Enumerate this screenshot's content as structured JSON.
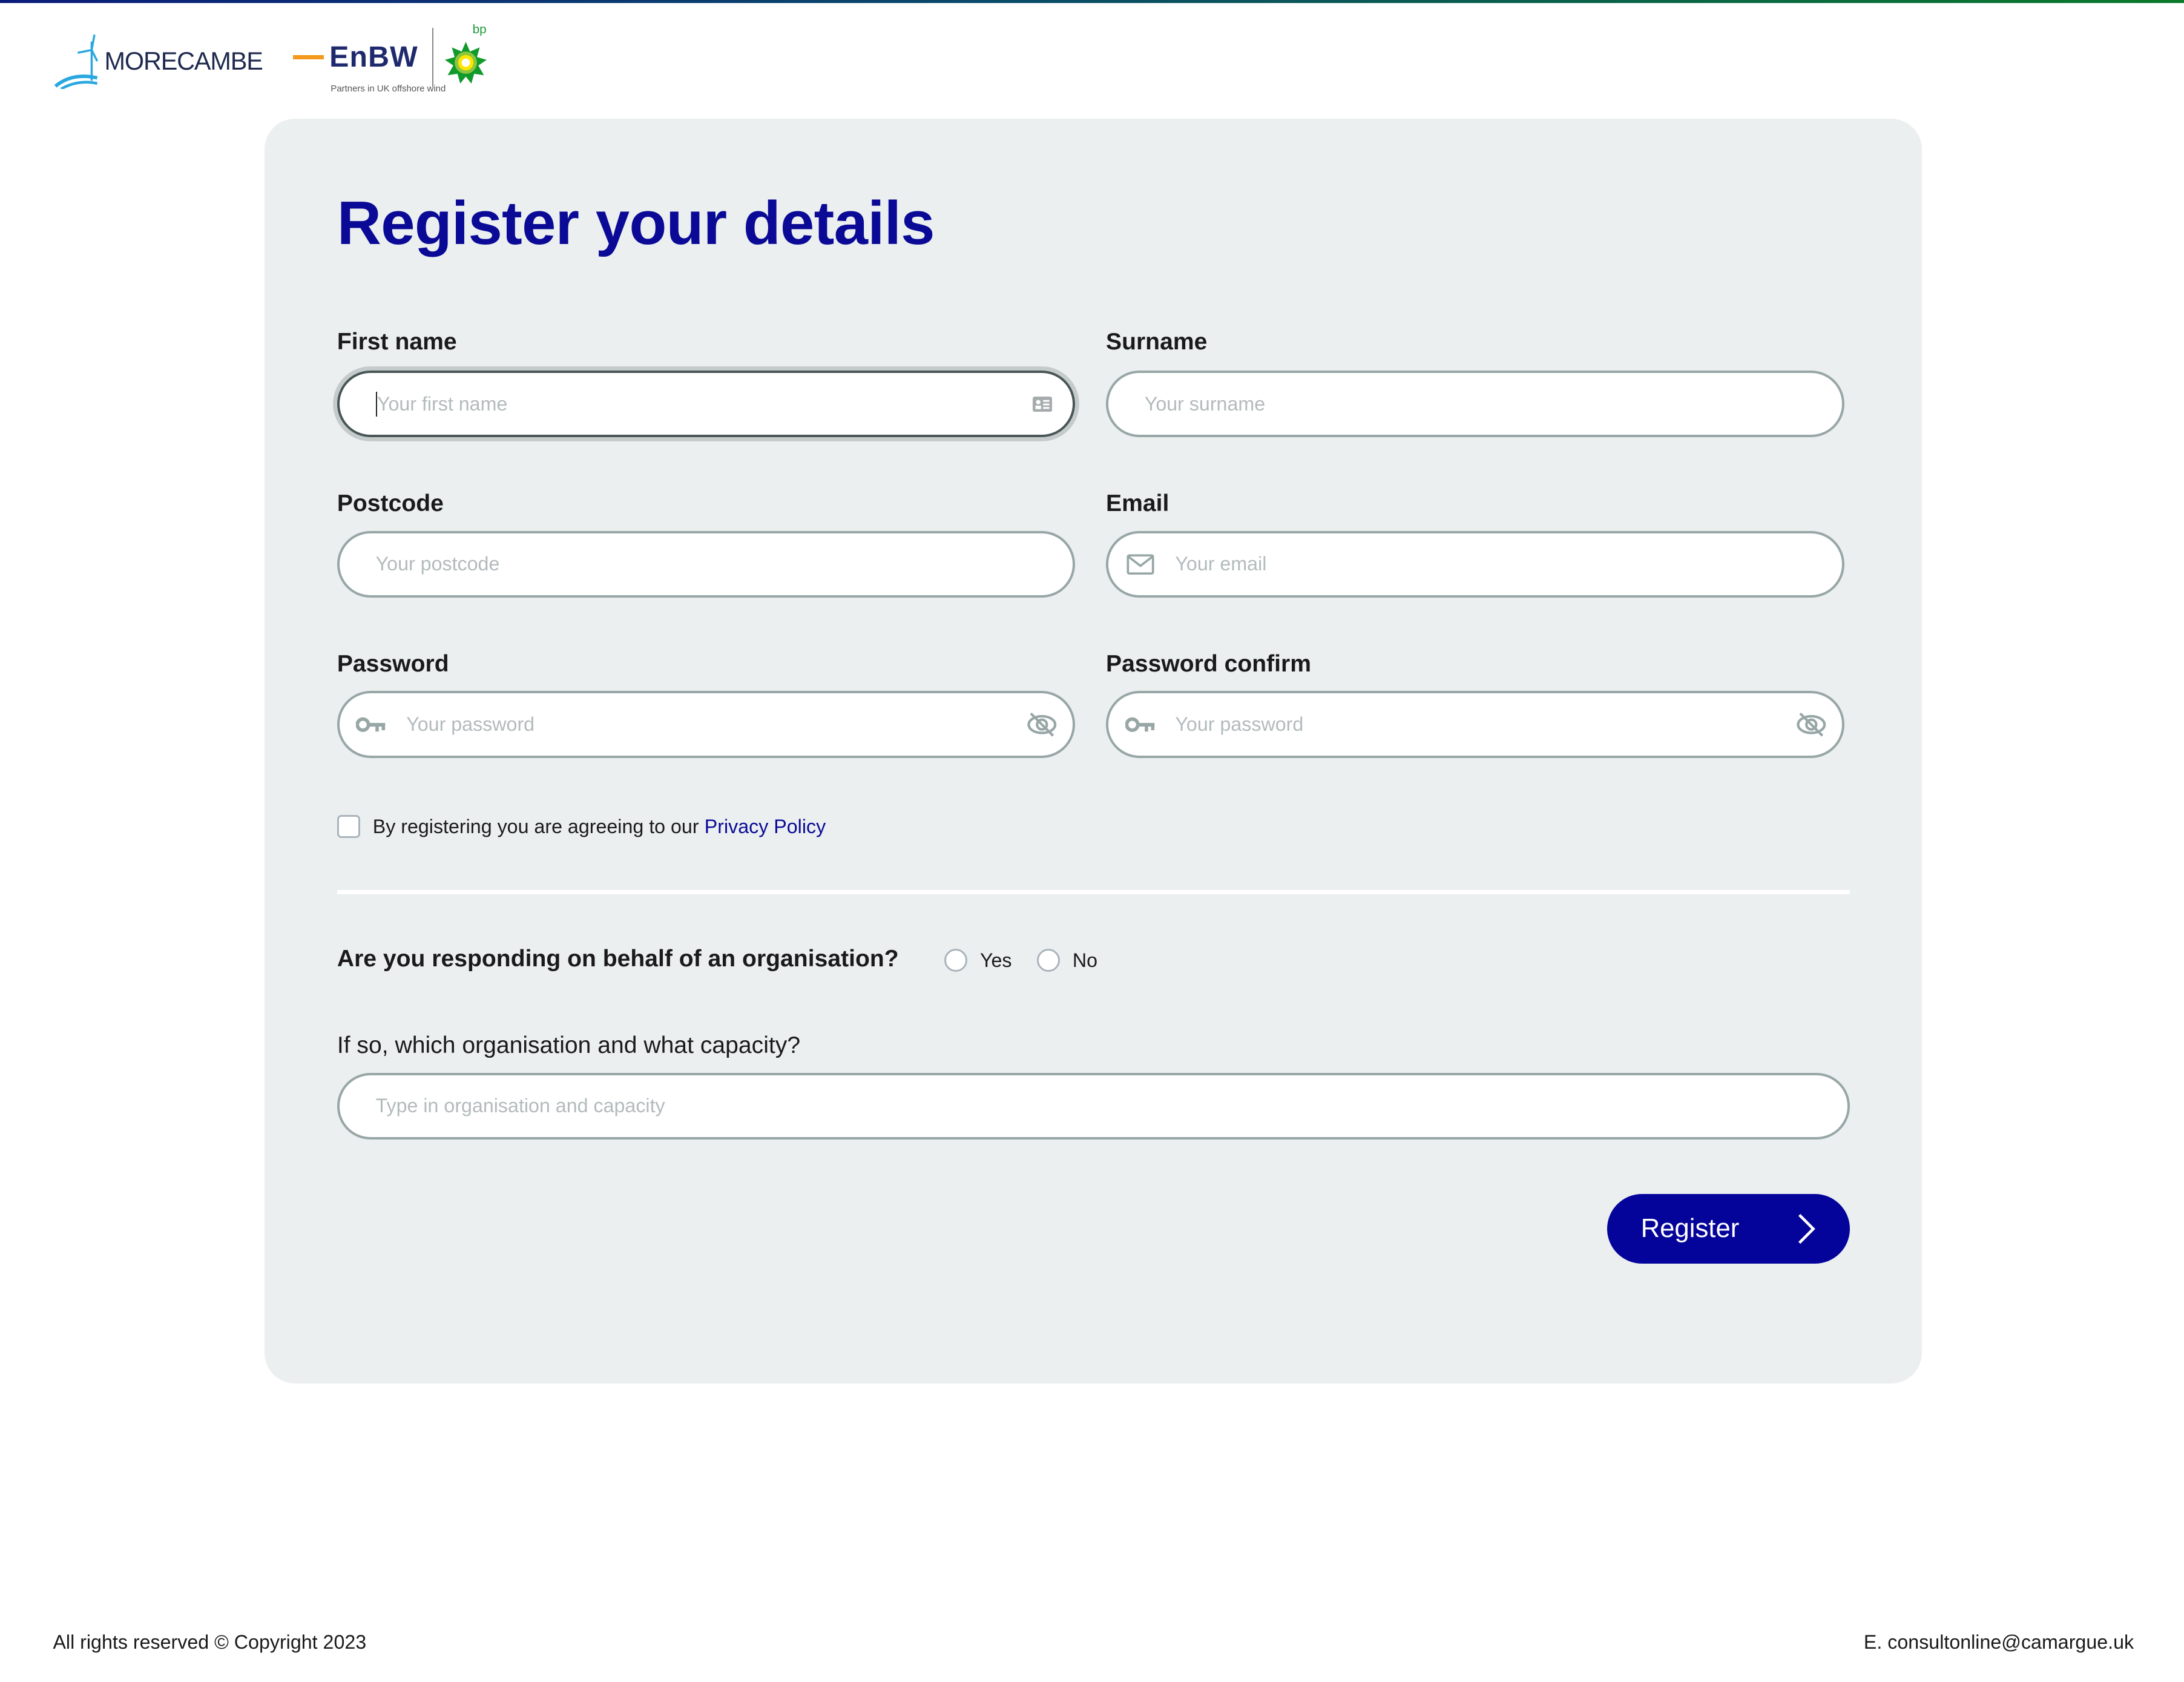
{
  "header": {
    "logo_primary": "MORECAMBE",
    "logo_partner": "EnBW",
    "logo_bp": "bp",
    "tagline": "Partners in UK offshore wind"
  },
  "form": {
    "title": "Register your details",
    "fields": {
      "first_name": {
        "label": "First name",
        "placeholder": "Your first name",
        "value": "",
        "icon_right": "contact-card-icon"
      },
      "surname": {
        "label": "Surname",
        "placeholder": "Your surname",
        "value": ""
      },
      "postcode": {
        "label": "Postcode",
        "placeholder": "Your postcode",
        "value": ""
      },
      "email": {
        "label": "Email",
        "placeholder": "Your email",
        "value": "",
        "icon_left": "envelope-icon"
      },
      "password": {
        "label": "Password",
        "placeholder": "Your password",
        "value": "",
        "icon_left": "key-icon",
        "icon_right": "eye-off-icon"
      },
      "password_confirm": {
        "label": "Password confirm",
        "placeholder": "Your password",
        "value": "",
        "icon_left": "key-icon",
        "icon_right": "eye-off-icon"
      }
    },
    "agreement": {
      "text": "By registering you are agreeing to our",
      "link": "Privacy Policy",
      "checked": false
    },
    "organisation_question": {
      "label": "Are you responding on behalf of an organisation?",
      "options": [
        "Yes",
        "No"
      ],
      "selected": null
    },
    "organisation_detail": {
      "label": "If so, which organisation and what capacity?",
      "placeholder": "Type in organisation and capacity",
      "value": ""
    },
    "submit_label": "Register"
  },
  "footer": {
    "copyright": "All rights reserved © Copyright 2023",
    "contact": "E. consultonline@camargue.uk"
  },
  "colors": {
    "brand_primary": "#04049a",
    "card_bg": "#ebeff0",
    "field_border": "#98a6a6",
    "link": "#0a0a96"
  }
}
